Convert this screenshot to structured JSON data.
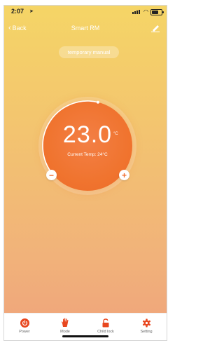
{
  "status_bar": {
    "time": "2:07"
  },
  "nav": {
    "back_label": "Back",
    "title": "Smart RM"
  },
  "mode_pill": "temporary manual",
  "dial": {
    "set_temp": "23.0",
    "unit": "°C",
    "current_temp": "Current Temp: 24°C",
    "progress_fraction": 0.55
  },
  "tabs": [
    {
      "label": "Power",
      "icon": "power-icon"
    },
    {
      "label": "Mode",
      "icon": "hand-icon"
    },
    {
      "label": "Child lock",
      "icon": "lock-icon"
    },
    {
      "label": "Setting",
      "icon": "gear-icon"
    }
  ],
  "colors": {
    "accent": "#f06e2e",
    "dial": "#f0742f",
    "gradient_top": "#f5d566",
    "gradient_bottom": "#efa37c"
  }
}
